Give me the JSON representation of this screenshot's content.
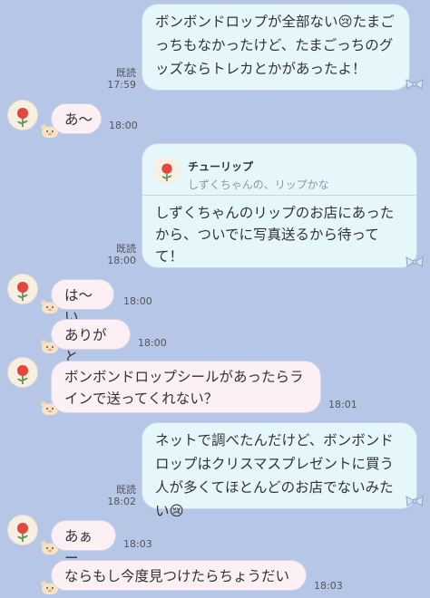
{
  "read_label": "既読",
  "messages": [
    {
      "side": "out",
      "text": "ボンボンドロップが全部ない😢たまごっちもなかったけど、たまごっちのグッズならトレカとかがあったよ！",
      "time": "17:59",
      "read": true
    },
    {
      "side": "in",
      "text": "あ〜",
      "time": "18:00"
    },
    {
      "side": "out",
      "reply": {
        "name": "チューリップ",
        "text": "しずくちゃんの、リップかな"
      },
      "text": "しずくちゃんのリップのお店にあったから、ついでに写真送るから待ってて！",
      "time": "18:00",
      "read": true
    },
    {
      "side": "in",
      "text": "は〜い",
      "time": "18:00"
    },
    {
      "side": "in",
      "text": "ありがと",
      "time": "18:00"
    },
    {
      "side": "in",
      "text": "ボンボンドロップシールがあったらラインで送ってくれない？",
      "time": "18:01"
    },
    {
      "side": "out",
      "text": "ネットで調べたんだけど、ボンボンドロップはクリスマスプレゼントに買う人が多くてほとんどのお店でないみたい😢",
      "time": "18:02",
      "read": true
    },
    {
      "side": "in",
      "text": "あぁー",
      "time": "18:03"
    },
    {
      "side": "in",
      "text": "ならもし今度見つけたらちょうだい",
      "time": "18:03"
    }
  ]
}
